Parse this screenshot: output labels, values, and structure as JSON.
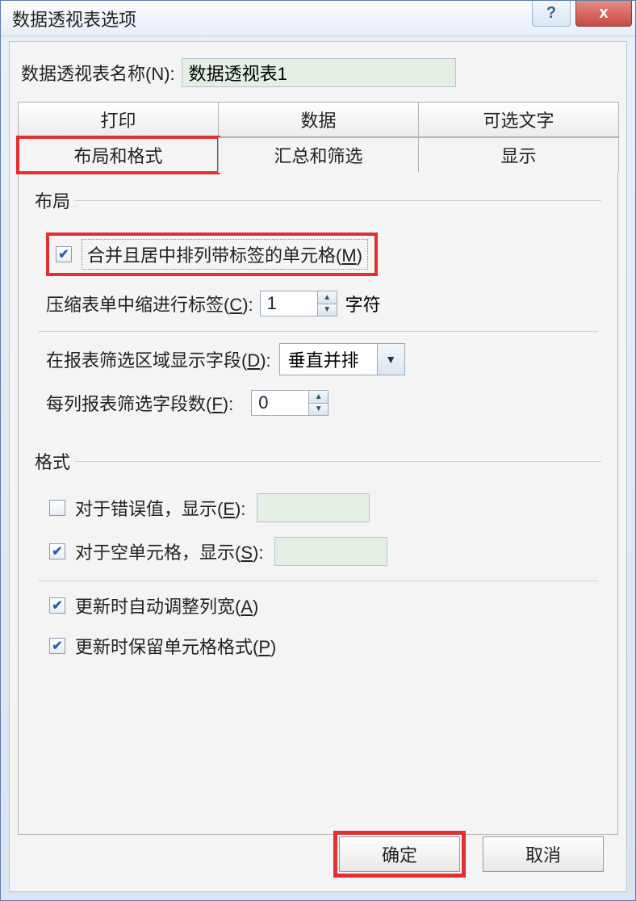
{
  "window": {
    "title": "数据透视表选项"
  },
  "titlebar": {
    "help": "?",
    "close": "x"
  },
  "name_row": {
    "label": "数据透视表名称(N):",
    "value": "数据透视表1"
  },
  "tabs": {
    "row1": [
      "打印",
      "数据",
      "可选文字"
    ],
    "row2": [
      "布局和格式",
      "汇总和筛选",
      "显示"
    ]
  },
  "layout": {
    "legend": "布局",
    "merge_label_pre": "合并且居中排列带标签的单元格(",
    "merge_label_u": "M",
    "merge_label_post": ")",
    "indent_label_pre": "压缩表单中缩进行标签(",
    "indent_label_u": "C",
    "indent_label_post": "):",
    "indent_value": "1",
    "indent_suffix": "字符",
    "fields_label_pre": "在报表筛选区域显示字段(",
    "fields_label_u": "D",
    "fields_label_post": "):",
    "fields_value": "垂直并排",
    "perrow_label_pre": "每列报表筛选字段数(",
    "perrow_label_u": "F",
    "perrow_label_post": "):",
    "perrow_value": "0"
  },
  "format": {
    "legend": "格式",
    "err_label_pre": "对于错误值，显示(",
    "err_label_u": "E",
    "err_label_post": "):",
    "empty_label_pre": "对于空单元格，显示(",
    "empty_label_u": "S",
    "empty_label_post": "):",
    "autofit_label_pre": "更新时自动调整列宽(",
    "autofit_label_u": "A",
    "autofit_label_post": ")",
    "preserve_label_pre": "更新时保留单元格格式(",
    "preserve_label_u": "P",
    "preserve_label_post": ")"
  },
  "buttons": {
    "ok": "确定",
    "cancel": "取消"
  }
}
